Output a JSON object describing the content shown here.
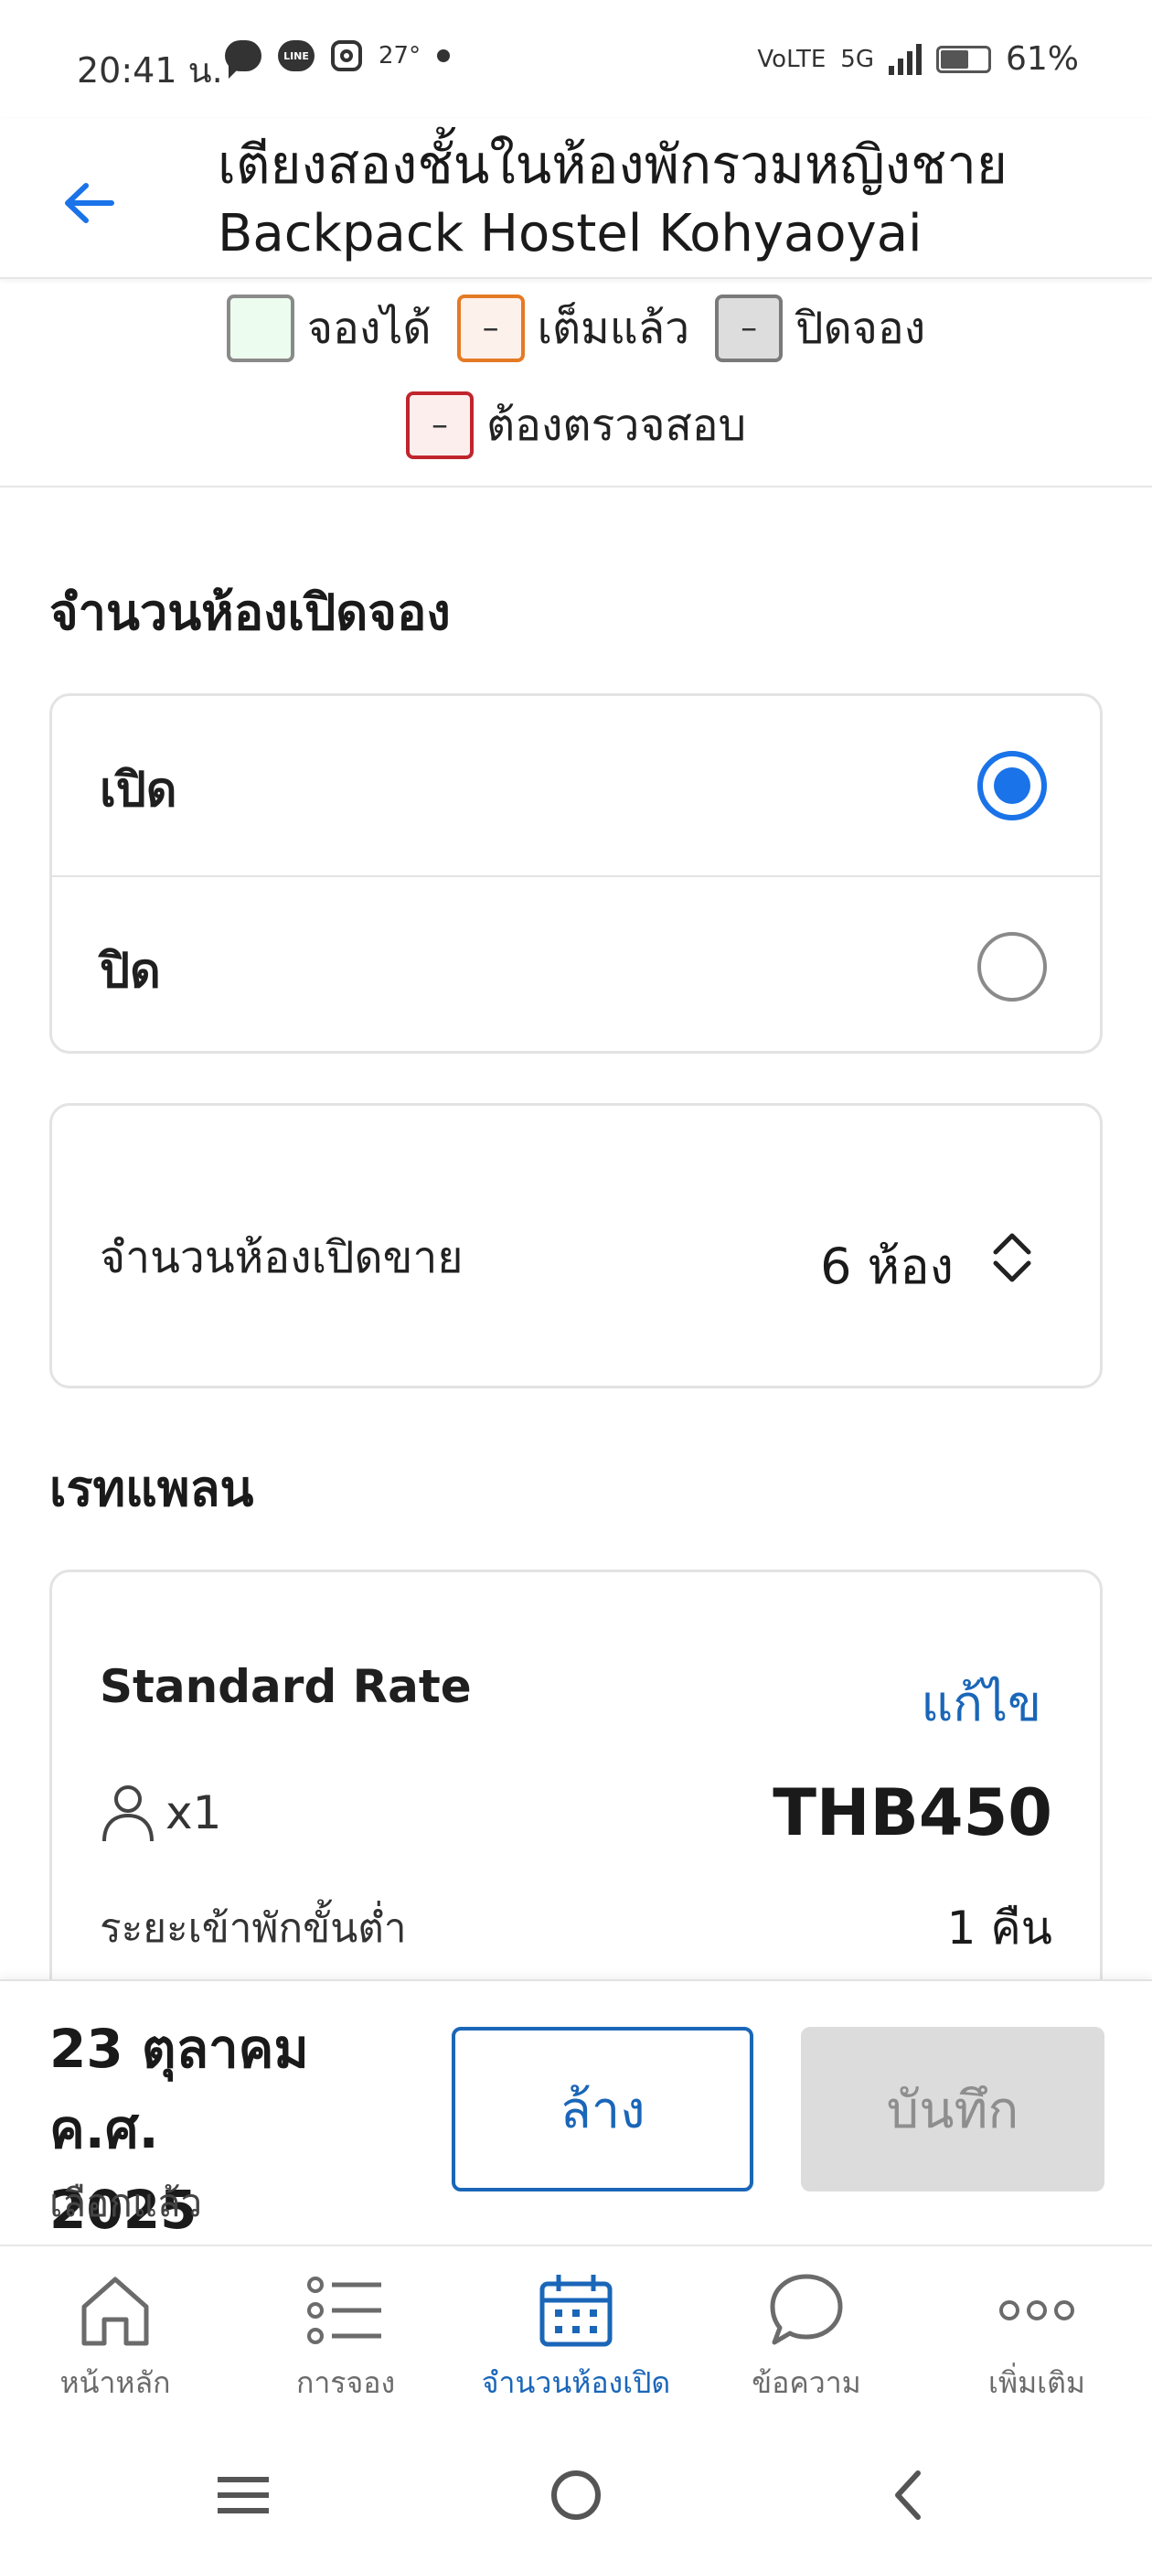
{
  "status_bar": {
    "time": "20:41 น.",
    "temperature": "27°",
    "network": "5G",
    "volte": "VoLTE",
    "battery": "61%",
    "battery_level": 0.61,
    "line_label": "LINE"
  },
  "header": {
    "title": "เตียงสองชั้นในห้องพักรวมหญิงชาย",
    "subtitle": "Backpack Hostel Kohyaoyai"
  },
  "legend": {
    "items": [
      {
        "label": "จองได้",
        "symbol": ""
      },
      {
        "label": "เต็มแล้ว",
        "symbol": "–"
      },
      {
        "label": "ปิดจอง",
        "symbol": "–"
      },
      {
        "label": "ต้องตรวจสอบ",
        "symbol": "–"
      }
    ]
  },
  "availability": {
    "section_title": "จำนวนห้องเปิดจอง",
    "options": [
      {
        "label": "เปิด",
        "selected": true
      },
      {
        "label": "ปิด",
        "selected": false
      }
    ]
  },
  "quantity": {
    "label": "จำนวนห้องเปิดขาย",
    "value": "6 ห้อง"
  },
  "rate_plan": {
    "section_title": "เรทแพลน",
    "name": "Standard Rate",
    "edit_label": "แก้ไข",
    "occupancy": "x1",
    "price": "THB450",
    "min_stay_label": "ระยะเข้าพักขั้นต่ำ",
    "min_stay_value": "1 คืน"
  },
  "action_bar": {
    "date_line1": "23 ตุลาคม ค.ศ.",
    "date_line2": "2025",
    "selected_label": "เลือกแล้ว",
    "clear_label": "ล้าง",
    "save_label": "บันทึก"
  },
  "bottom_nav": {
    "items": [
      {
        "label": "หน้าหลัก",
        "icon": "home-icon"
      },
      {
        "label": "การจอง",
        "icon": "list-icon"
      },
      {
        "label": "จำนวนห้องเปิด",
        "icon": "calendar-icon"
      },
      {
        "label": "ข้อความ",
        "icon": "chat-icon"
      },
      {
        "label": "เพิ่มเติม",
        "icon": "more-icon"
      }
    ],
    "active_index": 2
  },
  "colors": {
    "accent": "#1a66b8",
    "radio_selected": "#1a73e8",
    "legend_open": "#ecfcef",
    "legend_full": "#e57a24",
    "legend_closed": "#dddddd",
    "legend_check": "#c0252d",
    "save_disabled": "#dcdcdc"
  }
}
